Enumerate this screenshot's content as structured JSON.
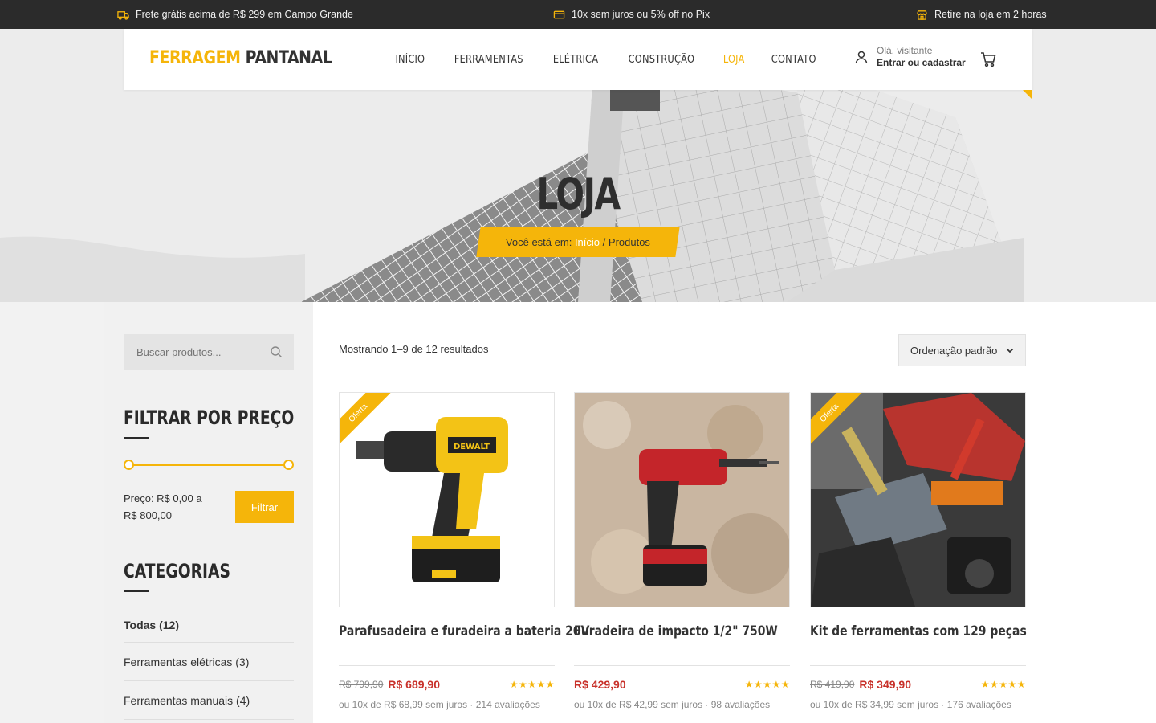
{
  "topbar": {
    "items": [
      {
        "icon": "truck-icon",
        "text": "Frete grátis acima de R$ 299 em Campo Grande"
      },
      {
        "icon": "card-icon",
        "text": "10x sem juros ou 5% off no Pix"
      },
      {
        "icon": "store-icon",
        "text": "Retire na loja em 2 horas"
      }
    ]
  },
  "header": {
    "logo_part1": "FERRAGEM",
    "logo_part2": "PANTANAL",
    "nav": [
      "INÍCIO",
      "FERRAMENTAS",
      "ELÉTRICA",
      "CONSTRUÇÃO",
      "LOJA",
      "CONTATO"
    ],
    "nav_active": "LOJA",
    "account_greeting": "Olá, visitante",
    "account_action": "Entrar ou cadastrar"
  },
  "hero": {
    "title": "LOJA",
    "breadcrumb_prefix": "Você está em:",
    "breadcrumb_link": "Início",
    "breadcrumb_sep": "/",
    "breadcrumb_current": "Produtos"
  },
  "sidebar": {
    "search_placeholder": "Buscar produtos...",
    "price_filter_title": "FILTRAR POR PREÇO",
    "price_label_line1": "Preço: R$ 0,00 a",
    "price_label_line2": "R$ 800,00",
    "filter_button": "Filtrar",
    "categories_title": "CATEGORIAS",
    "categories": [
      "Todas (12)",
      "Ferramentas elétricas (3)",
      "Ferramentas manuais (4)"
    ]
  },
  "main": {
    "result_count": "Mostrando 1–9 de 12 resultados",
    "sort_selected": "Ordenação padrão",
    "products": [
      {
        "name": "Parafusadeira e furadeira a bateria 20V",
        "badge": "Oferta",
        "old_price": "R$ 799,90",
        "price": "R$ 689,90",
        "rating": 5,
        "installments": "ou 10x de R$ 68,99 sem juros · 214 avaliações"
      },
      {
        "name": "Furadeira de impacto 1/2\" 750W",
        "badge": "",
        "old_price": "",
        "price": "R$ 429,90",
        "rating": 5,
        "installments": "ou 10x de R$ 42,99 sem juros · 98 avaliações"
      },
      {
        "name": "Kit de ferramentas com 129 peças",
        "badge": "Oferta",
        "old_price": "R$ 419,90",
        "price": "R$ 349,90",
        "rating": 5,
        "installments": "ou 10x de R$ 34,99 sem juros · 176 avaliações"
      }
    ]
  },
  "colors": {
    "accent": "#f5b50a",
    "topbar_bg": "#2b2b2b",
    "sale_price": "#c8312a"
  }
}
